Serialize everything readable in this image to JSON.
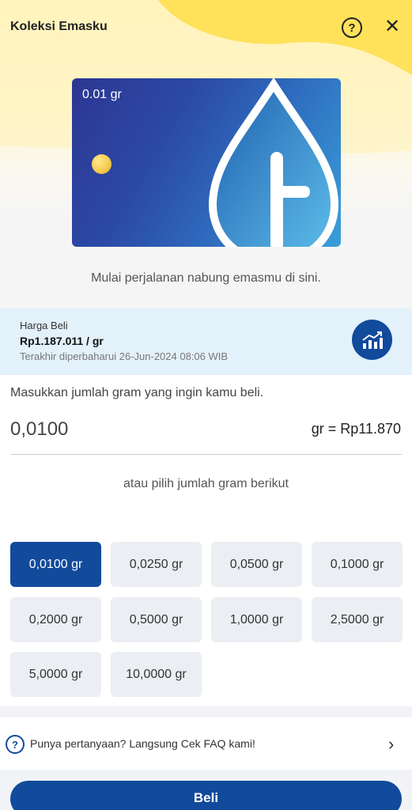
{
  "header": {
    "title": "Koleksi Emasku",
    "help_icon_label": "?",
    "close_icon_label": "✕"
  },
  "card": {
    "weight": "0.01 gr",
    "colors": {
      "start": "#2d3692",
      "end": "#3a9fd8",
      "chip": "#f2c94c"
    }
  },
  "tagline": "Mulai perjalanan nabung emasmu di sini.",
  "price": {
    "label": "Harga Beli",
    "value": "Rp1.187.011 / gr",
    "updated": "Terakhir diperbaharui 26-Jun-2024 08:06 WIB",
    "icon": "trending-up-chart-icon"
  },
  "input": {
    "prompt": "Masukkan jumlah gram yang ingin kamu beli.",
    "value": "0,0100",
    "conversion": "gr = Rp11.870"
  },
  "options": {
    "heading": "atau pilih jumlah gram berikut",
    "items": [
      {
        "label": "0,0100 gr",
        "selected": true
      },
      {
        "label": "0,0250 gr",
        "selected": false
      },
      {
        "label": "0,0500 gr",
        "selected": false
      },
      {
        "label": "0,1000 gr",
        "selected": false
      },
      {
        "label": "0,2000 gr",
        "selected": false
      },
      {
        "label": "0,5000 gr",
        "selected": false
      },
      {
        "label": "1,0000 gr",
        "selected": false
      },
      {
        "label": "2,5000 gr",
        "selected": false
      },
      {
        "label": "5,0000 gr",
        "selected": false
      },
      {
        "label": "10,0000 gr",
        "selected": false
      }
    ]
  },
  "faq": {
    "icon_label": "?",
    "text": "Punya pertanyaan? Langsung Cek FAQ kami!",
    "chevron": "›"
  },
  "buy_button": {
    "label": "Beli"
  },
  "colors": {
    "primary": "#124a9c",
    "price_bg": "#e3f1fb",
    "accent_yellow": "#ffe15a"
  }
}
